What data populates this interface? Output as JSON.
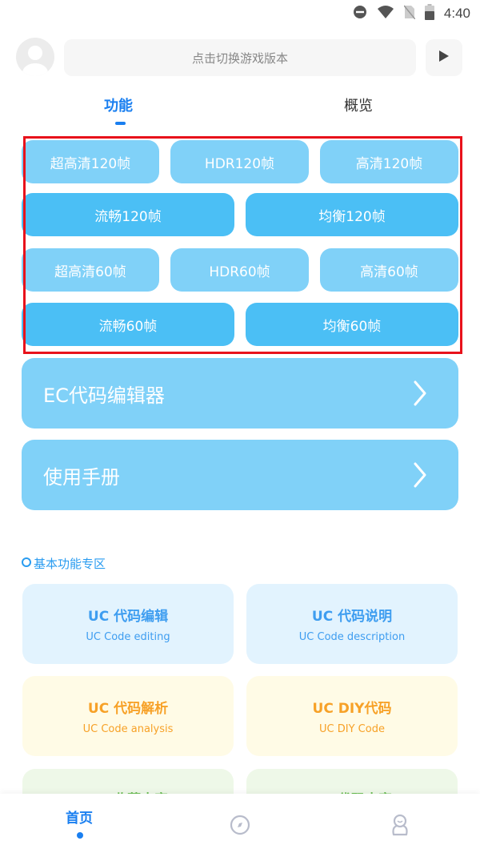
{
  "status_bar": {
    "time": "4:40",
    "icons": [
      "do-not-disturb-icon",
      "wifi-icon",
      "no-sim-icon",
      "battery-icon"
    ]
  },
  "header": {
    "avatar_icon": "user-avatar-icon",
    "search_placeholder": "点击切换游戏版本",
    "play_icon": "play-icon"
  },
  "tabs": [
    {
      "label": "功能",
      "active": true
    },
    {
      "label": "概览",
      "active": false
    }
  ],
  "presets": {
    "row1": [
      "超高清120帧",
      "HDR120帧",
      "高清120帧"
    ],
    "row2": [
      "流畅120帧",
      "均衡120帧"
    ],
    "row3": [
      "超高清60帧",
      "HDR60帧",
      "高清60帧"
    ],
    "row4": [
      "流畅60帧",
      "均衡60帧"
    ]
  },
  "cards": [
    {
      "label": "EC代码编辑器",
      "icon": "chevron-right-icon"
    },
    {
      "label": "使用手册",
      "icon": "chevron-right-icon"
    }
  ],
  "section": {
    "title": "基本功能专区",
    "icon": "circle-icon"
  },
  "features": [
    {
      "title": "UC 代码编辑",
      "subtitle": "UC Code editing",
      "color": "#3e9df0"
    },
    {
      "title": "UC 代码说明",
      "subtitle": "UC Code description",
      "color": "#3e9df0"
    },
    {
      "title": "UC 代码解析",
      "subtitle": "UC Code analysis",
      "color": "#f7a127"
    },
    {
      "title": "UC DIY代码",
      "subtitle": "UC DIY Code",
      "color": "#f7a127"
    },
    {
      "title": "UC 收藏内容",
      "subtitle": "",
      "color": "#62b94a"
    },
    {
      "title": "UC 代码内容",
      "subtitle": "",
      "color": "#62b94a"
    }
  ],
  "bottom_nav": [
    {
      "label": "首页",
      "active": true
    },
    {
      "label": "",
      "icon": "compass-icon",
      "active": false
    },
    {
      "label": "",
      "icon": "profile-icon",
      "active": false
    }
  ],
  "colors": {
    "accent": "#1a7ff0",
    "preset_light": "#80d1f8",
    "preset_dark": "#4bbff5",
    "highlight_border": "#e8121b"
  }
}
